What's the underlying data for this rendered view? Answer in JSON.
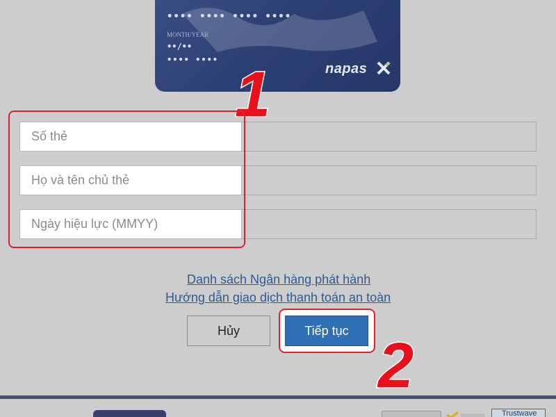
{
  "card": {
    "number_mask": "•••• •••• •••• ••••",
    "expiry_label": "MONTH/YEAR",
    "expiry_mask": "••/••",
    "cvv_mask": "•••• ••••",
    "brand": "napas"
  },
  "annotations": {
    "step1": "1",
    "step2": "2"
  },
  "form": {
    "card_number_placeholder": "Số thẻ",
    "cardholder_placeholder": "Họ và tên chủ thẻ",
    "validity_placeholder": "Ngày hiệu lực (MMYY)"
  },
  "links": {
    "issuing_banks": "Danh sách Ngân hàng phát hành",
    "safe_payment_guide": "Hướng dẫn giao dịch thanh toán an toàn"
  },
  "buttons": {
    "cancel": "Hủy",
    "continue": "Tiếp tục"
  },
  "footer": {
    "trustwave_label": "Trustwave"
  },
  "colors": {
    "card_blue": "#2c3f73",
    "accent_red": "#e2202b",
    "primary_button": "#2f6fb3",
    "link": "#2e5a8f"
  }
}
